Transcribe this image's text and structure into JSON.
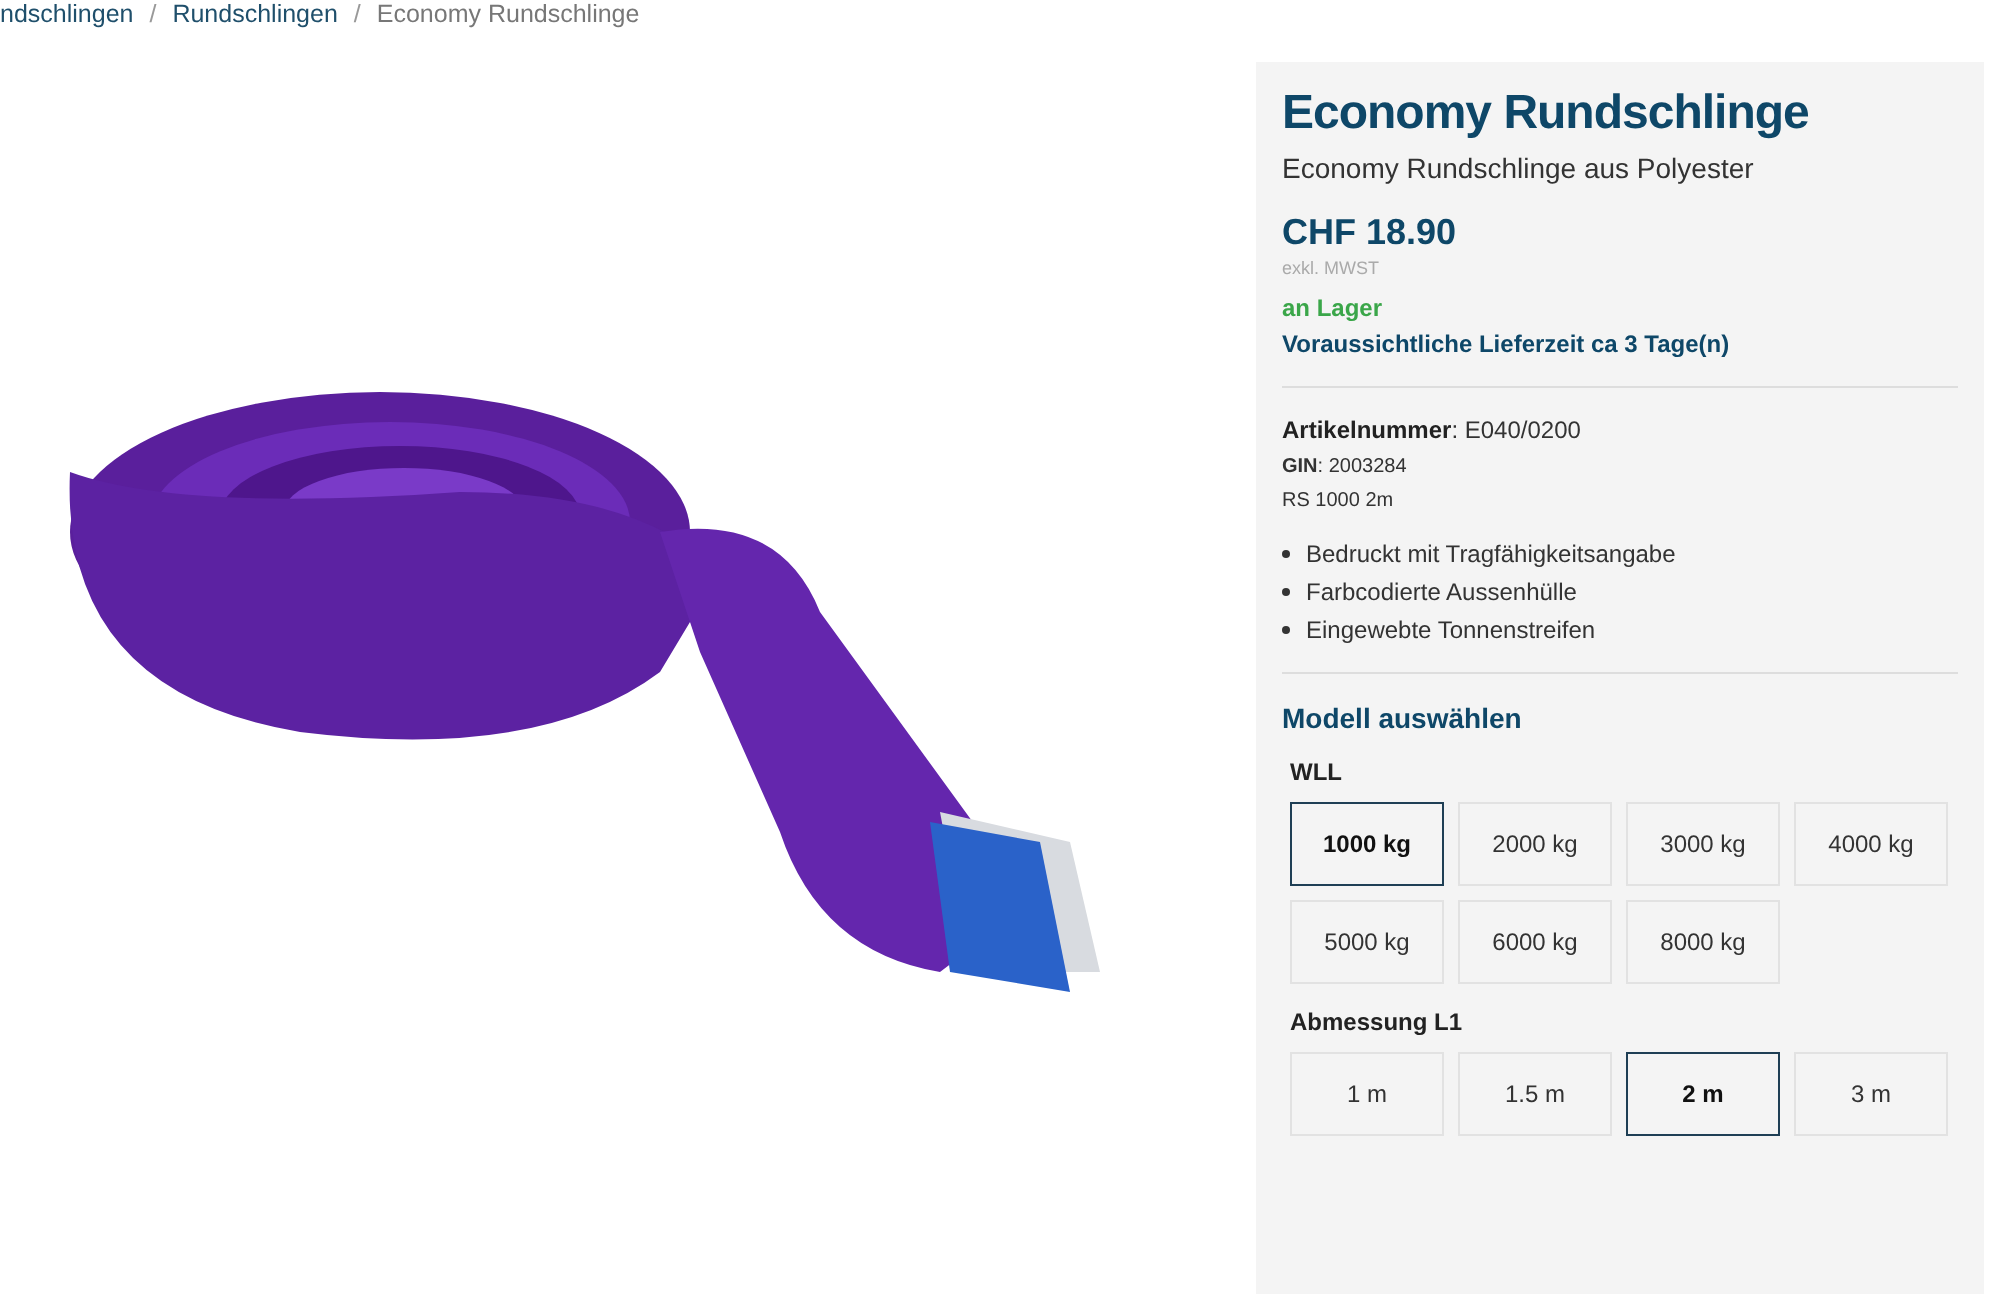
{
  "breadcrumb_separator": "/",
  "breadcrumb": [
    {
      "label": "ndschlingen",
      "current": false
    },
    {
      "label": "Rundschlingen",
      "current": false
    },
    {
      "label": "Economy Rundschlinge",
      "current": true
    }
  ],
  "product": {
    "title": "Economy Rundschlinge",
    "subtitle": "Economy Rundschlinge aus Polyester",
    "price": "CHF 18.90",
    "tax_note": "exkl. MWST",
    "stock": "an Lager",
    "delivery": "Voraussichtliche Lieferzeit ca 3 Tage(n)",
    "article_label": "Artikelnummer",
    "article_value": ": E040/0200",
    "gin_label": "GIN",
    "gin_value": ": 2003284",
    "model_code": "RS 1000 2m",
    "features": [
      "Bedruckt mit Tragfähigkeitsangabe",
      "Farbcodierte Aussenhülle",
      "Eingewebte Tonnenstreifen"
    ]
  },
  "variant_heading": "Modell auswählen",
  "option_groups": [
    {
      "label": "WLL",
      "options": [
        {
          "label": "1000 kg",
          "selected": true
        },
        {
          "label": "2000 kg",
          "selected": false
        },
        {
          "label": "3000 kg",
          "selected": false
        },
        {
          "label": "4000 kg",
          "selected": false
        },
        {
          "label": "5000 kg",
          "selected": false
        },
        {
          "label": "6000 kg",
          "selected": false
        },
        {
          "label": "8000 kg",
          "selected": false
        }
      ]
    },
    {
      "label": "Abmessung L1",
      "options": [
        {
          "label": "1 m",
          "selected": false
        },
        {
          "label": "1.5 m",
          "selected": false
        },
        {
          "label": "2 m",
          "selected": true
        },
        {
          "label": "3 m",
          "selected": false
        }
      ]
    }
  ]
}
